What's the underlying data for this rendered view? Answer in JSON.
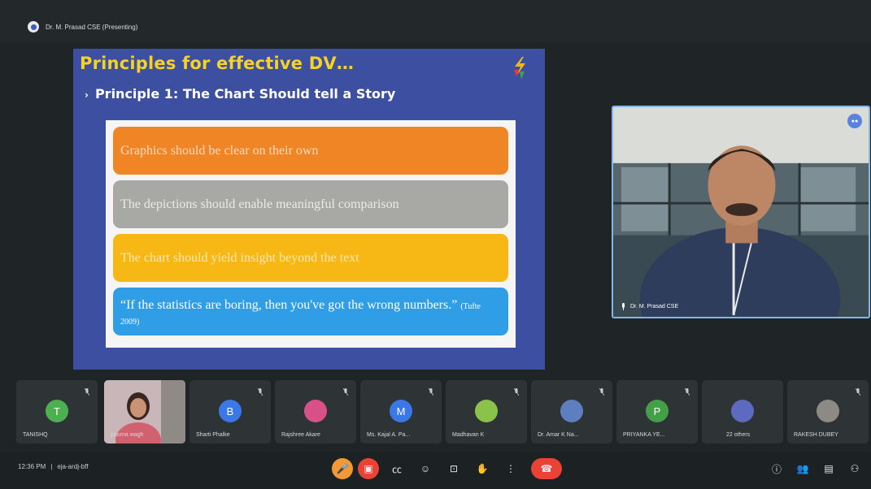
{
  "topbar": {
    "presenter_label": "Dr. M. Prasad CSE (Presenting)"
  },
  "slide": {
    "title": "Principles for effective DV…",
    "subtitle": "Principle 1: The Chart Should tell a Story",
    "bullet": "›",
    "items": [
      "Graphics should be clear on their own",
      "The depictions should enable meaningful comparison",
      "The chart should yield insight beyond the text"
    ],
    "quote": "“If the statistics are boring, then you've got the wrong numbers.”",
    "quote_cite": "(Tufte 2009)"
  },
  "presenter_video": {
    "name": "Dr. M. Prasad CSE"
  },
  "participants": [
    {
      "name": "TANISHQ",
      "initial": "T",
      "color": "#4caf50",
      "type": "avatar"
    },
    {
      "name": "poorna wagh",
      "initial": "",
      "color": "#c96b7a",
      "type": "video"
    },
    {
      "name": "Sharti Phalke",
      "initial": "B",
      "color": "#3b78e7",
      "type": "avatar"
    },
    {
      "name": "Rajshree Akare",
      "initial": "",
      "color": "#d94f8a",
      "type": "photo"
    },
    {
      "name": "Ms. Kajal A. Pa...",
      "initial": "M",
      "color": "#3b78e7",
      "type": "avatar"
    },
    {
      "name": "Madhavan K",
      "initial": "",
      "color": "#8bc34a",
      "type": "photo"
    },
    {
      "name": "Dr. Amar K Na...",
      "initial": "",
      "color": "#5d7fbf",
      "type": "photo"
    },
    {
      "name": "PRIYANKA YE...",
      "initial": "P",
      "color": "#43a047",
      "type": "avatar"
    },
    {
      "name": "22 others",
      "initial": "",
      "color": "#5c6bc0",
      "type": "others"
    },
    {
      "name": "RAKESH DUBEY",
      "initial": "",
      "color": "#8d8a86",
      "type": "photo"
    }
  ],
  "bottombar": {
    "time": "12:36 PM",
    "separator": "|",
    "meeting_code": "eja-ardj-bff"
  },
  "icons": {
    "mic": "mic-off-icon",
    "camera": "camera-off-icon",
    "captions": "captions-icon",
    "emoji": "emoji-icon",
    "present": "present-screen-icon",
    "hand": "raise-hand-icon",
    "more": "more-options-icon",
    "leave": "leave-call-icon",
    "info": "info-icon",
    "people": "people-icon",
    "chat": "chat-icon",
    "activities": "activities-icon"
  },
  "colors": {
    "leave_red": "#ea4335",
    "slide_blue": "#3c4fa0",
    "title_yellow": "#f6d126"
  }
}
